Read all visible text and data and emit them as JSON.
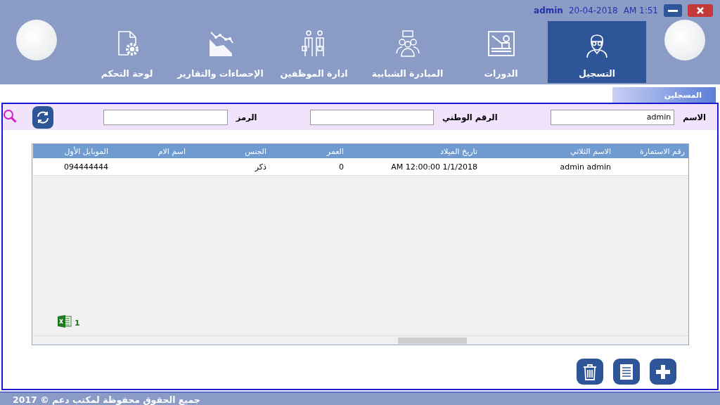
{
  "top_bar": {
    "user": "admin",
    "date": "20-04-2018",
    "time": "AM 1:51"
  },
  "nav_tabs": [
    {
      "label": "التسجيل",
      "selected": true
    },
    {
      "label": "الدورات",
      "selected": false
    },
    {
      "label": "المبادرة الشبابية",
      "selected": false
    },
    {
      "label": "ادارة الموظفين",
      "selected": false
    },
    {
      "label": "الإحصاءات والتقارير",
      "selected": false
    },
    {
      "label": "لوحة التحكم",
      "selected": false
    }
  ],
  "section_tab": "المسجلين",
  "filters": [
    {
      "label": "الاسم",
      "value": "admin"
    },
    {
      "label": "الرقم الوطني"
    },
    {
      "label": "الرمز"
    }
  ],
  "table": {
    "columns": [
      "رقم الاستمارة",
      "الاسم الثلاثي",
      "تاريخ الميلاد",
      "العمر",
      "الجنس",
      "اسم الام",
      "الموبايل الأول"
    ],
    "rows": [
      [
        null,
        "admin  admin",
        "AM 12:00:00 1/1/2018",
        "0",
        "ذكر",
        null,
        "094444444"
      ]
    ],
    "export_count": "1"
  },
  "footer": "جميع الحقوق محفوظة لمكتب دعم © 2017"
}
